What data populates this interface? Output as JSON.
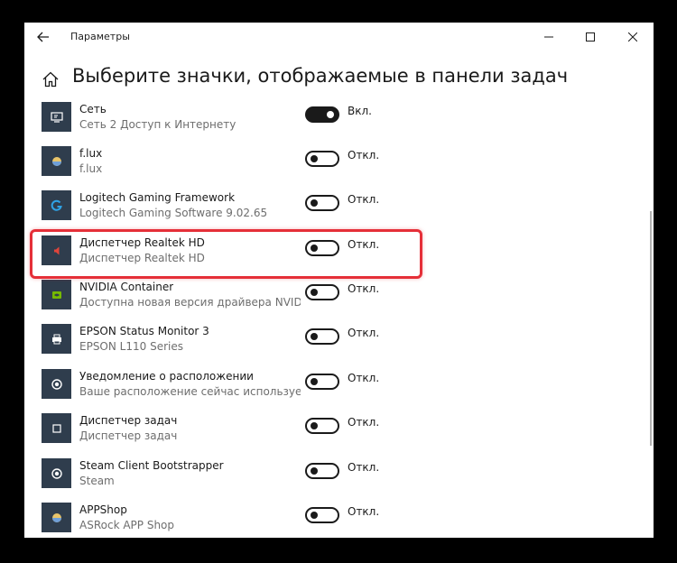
{
  "window": {
    "title": "Параметры",
    "controls": {
      "minimize": "—",
      "maximize": "☐",
      "close": "✕"
    }
  },
  "page": {
    "title": "Выберите значки, отображаемые в панели задач"
  },
  "items": [
    {
      "name": "Сеть",
      "subtitle": "Сеть 2 Доступ к Интернету",
      "state": "Вкл.",
      "on": true,
      "icon": "network-monitor-icon"
    },
    {
      "name": "f.lux",
      "subtitle": "f.lux",
      "state": "Откл.",
      "on": false,
      "icon": "flux-icon"
    },
    {
      "name": "Logitech Gaming Framework",
      "subtitle": "Logitech Gaming Software 9.02.65",
      "state": "Откл.",
      "on": false,
      "icon": "logitech-icon"
    },
    {
      "name": "Диспетчер Realtek HD",
      "subtitle": "Диспетчер Realtek HD",
      "state": "Откл.",
      "on": false,
      "icon": "speaker-icon"
    },
    {
      "name": "NVIDIA Container",
      "subtitle": "Доступна новая версия драйвера NVIDIA...",
      "state": "Откл.",
      "on": false,
      "icon": "nvidia-icon"
    },
    {
      "name": "EPSON Status Monitor 3",
      "subtitle": "EPSON L110 Series",
      "state": "Откл.",
      "on": false,
      "icon": "printer-icon"
    },
    {
      "name": "Уведомление о расположении",
      "subtitle": "Ваше расположение сейчас используется",
      "state": "Откл.",
      "on": false,
      "icon": "location-icon"
    },
    {
      "name": "Диспетчер задач",
      "subtitle": "Диспетчер задач",
      "state": "Откл.",
      "on": false,
      "icon": "task-manager-icon"
    },
    {
      "name": "Steam Client Bootstrapper",
      "subtitle": "Steam",
      "state": "Откл.",
      "on": false,
      "icon": "steam-icon"
    },
    {
      "name": "APPShop",
      "subtitle": "ASRock APP Shop",
      "state": "Откл.",
      "on": false,
      "icon": "appshop-icon"
    }
  ],
  "colors": {
    "tile": "#2f3d4d",
    "highlight": "#e52f38",
    "toggle": "#1a1a1a"
  }
}
